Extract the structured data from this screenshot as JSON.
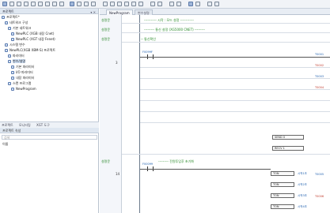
{
  "doc_tabs": [
    {
      "label": "NewProgram",
      "active": true
    },
    {
      "label": "변수설명",
      "active": false
    }
  ],
  "left_panel": {
    "title": "프로젝트",
    "tree": [
      {
        "label": "프로젝트*",
        "indent": 0
      },
      {
        "label": "네트워크 구성",
        "indent": 1
      },
      {
        "label": "기본 네트워크",
        "indent": 2
      },
      {
        "label": "NewPLC (XGB 내장 Cnet)",
        "indent": 3
      },
      {
        "label": "NewPLC (XGT 내장 Fenet)",
        "indent": 3
      },
      {
        "label": "시스템 변수",
        "indent": 1
      },
      {
        "label": "NewPLC(XGB XBM-S) 프로젝트",
        "indent": 1
      },
      {
        "label": "파라미터",
        "indent": 2
      },
      {
        "label": "변수/설명",
        "indent": 2,
        "selected": true
      },
      {
        "label": "기본 파라미터",
        "indent": 3
      },
      {
        "label": "I/O 파라미터",
        "indent": 3
      },
      {
        "label": "내장 파라미터",
        "indent": 3
      },
      {
        "label": "스캔 프로그램",
        "indent": 2
      },
      {
        "label": "NewProgram",
        "indent": 3
      }
    ],
    "bottom_tabs": [
      "프로젝트",
      "모니터링",
      "XGT 도구"
    ],
    "properties_title": "프로젝트 속성",
    "search_placeholder": "검색",
    "property_name_label": "이름"
  },
  "editor": {
    "rungs": [
      {
        "label": "설명문",
        "comment": "----------- 시작 : 모드 설정 ------------"
      },
      {
        "label": "설명문",
        "comment": "--------- 통신 설정 (XG5000 CNET) ---------"
      },
      {
        "label": "설명문",
        "comment": "-- 통신확인"
      },
      {
        "label": "설명문",
        "comment": "--------- 전원투입후 초기화"
      }
    ],
    "step_numbers": [
      "3",
      "14"
    ],
    "contact_labels": [
      "F0099F",
      "F00099"
    ],
    "function_blocks": [
      {
        "label": "SEND",
        "param": "0"
      },
      {
        "label": "RECV",
        "param": "1"
      },
      {
        "label": "TON",
        "param": "시작1초"
      },
      {
        "label": "TON",
        "param": "시작2초"
      },
      {
        "label": "TON",
        "param": "시작3초"
      },
      {
        "label": "TON",
        "param": "시작4초"
      },
      {
        "label": "TON",
        "param": "시작5초"
      },
      {
        "label": "TON",
        "param": "시작6초"
      }
    ],
    "values": [
      "T0001",
      "T0002",
      "T0003",
      "T0004",
      "T0005",
      "T0006"
    ],
    "colors": {
      "comment": "#2a8a2a",
      "variable": "#1e5fae",
      "alert": "#c0392b"
    }
  }
}
